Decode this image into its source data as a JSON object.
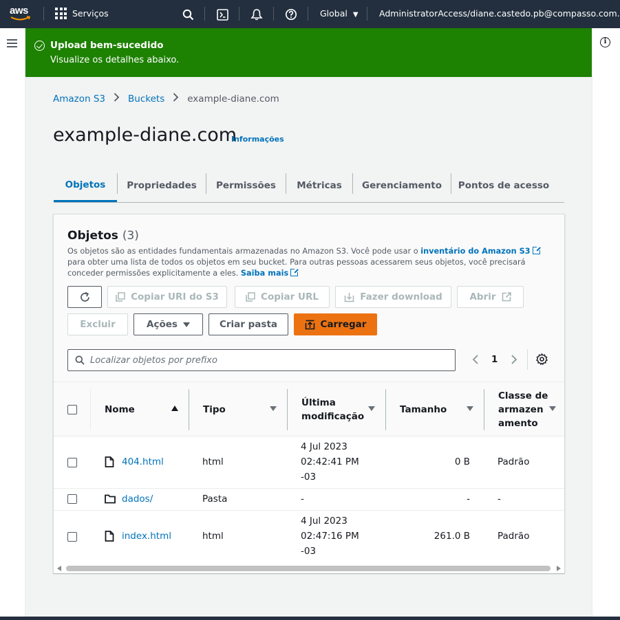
{
  "topnav": {
    "logo": "aws",
    "services_label": "Serviços",
    "region_label": "Global",
    "account_label": "AdministratorAccess/diane.castedo.pb@compasso.com.br",
    "icons": [
      "search-icon",
      "cloudshell-icon",
      "notifications-icon",
      "help-icon"
    ]
  },
  "flash": {
    "title": "Upload bem-sucedido",
    "message": "Visualize os detalhes abaixo.",
    "color": "#1d8102"
  },
  "breadcrumb": {
    "items": [
      "Amazon S3",
      "Buckets"
    ],
    "current": "example-diane.com"
  },
  "page": {
    "title": "example-diane.com",
    "info_link": "Informações"
  },
  "tabs": [
    "Objetos",
    "Propriedades",
    "Permissões",
    "Métricas",
    "Gerenciamento",
    "Pontos de acesso"
  ],
  "objects": {
    "title": "Objetos",
    "count": "(3)",
    "desc_1": "Os objetos são as entidades fundamentais armazenadas no Amazon S3. Você pode usar o ",
    "desc_link_1": "inventário do Amazon S3",
    "desc_2": " para obter uma lista de todos os objetos em seu bucket. Para outras pessoas acessarem seus objetos, você precisará conceder permissões explicitamente a eles. ",
    "desc_link_2": "Saiba mais",
    "buttons": {
      "copy_s3_uri": "Copiar URI do S3",
      "copy_url": "Copiar URL",
      "download": "Fazer download",
      "open": "Abrir",
      "delete": "Excluir",
      "actions": "Ações",
      "create_folder": "Criar pasta",
      "upload": "Carregar"
    },
    "search_placeholder": "Localizar objetos por prefixo",
    "page_number": "1",
    "columns": {
      "name": "Nome",
      "type": "Tipo",
      "modified_1": "Última",
      "modified_2": "modificação",
      "size": "Tamanho",
      "class_1": "Classe de",
      "class_2": "armazen",
      "class_3": "amento"
    },
    "rows": [
      {
        "name": "404.html",
        "type": "html",
        "mod_1": "4 Jul 2023",
        "mod_2": "02:42:41 PM",
        "mod_3": "-03",
        "size": "0 B",
        "class": "Padrão",
        "icon": "file-icon"
      },
      {
        "name": "dados/",
        "type": "Pasta",
        "mod_1": "-",
        "size": "-",
        "class": "-",
        "icon": "folder-icon"
      },
      {
        "name": "index.html",
        "type": "html",
        "mod_1": "4 Jul 2023",
        "mod_2": "02:47:16 PM",
        "mod_3": "-03",
        "size": "261.0 B",
        "class": "Padrão",
        "icon": "file-icon"
      }
    ]
  },
  "colors": {
    "nav_bg": "#232f3e",
    "link": "#0073bb",
    "primary_button": "#ec7211",
    "success": "#1d8102"
  }
}
